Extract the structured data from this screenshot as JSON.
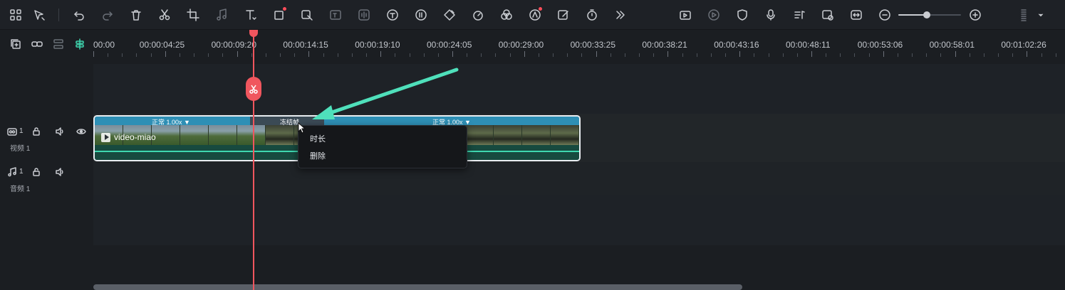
{
  "toolbar": {
    "icons": [
      "grid-icon",
      "select-tool-icon",
      "undo-icon",
      "redo-icon",
      "delete-icon",
      "cut-icon",
      "crop-icon",
      "audio-icon",
      "text-icon",
      "shape-icon",
      "ai-cutout-icon",
      "ai-text-icon",
      "voice-icon",
      "speech-to-text-icon",
      "text-to-speech-icon",
      "keyframe-icon",
      "speed-icon",
      "color-icon",
      "ai-effect-icon",
      "ai-edit-icon",
      "timer-icon",
      "more-icon"
    ],
    "right_icons": [
      "render-icon",
      "preview-icon",
      "shield-icon",
      "microphone-icon",
      "music-list-icon",
      "screen-record-icon",
      "fit-icon",
      "zoom-out-icon",
      "zoom-in-icon",
      "layout-icon"
    ],
    "zoom_level": 0.45
  },
  "ruler": {
    "ticks": [
      "00:00",
      "00:00:04:25",
      "00:00:09:20",
      "00:00:14:15",
      "00:00:19:10",
      "00:00:24:05",
      "00:00:29:00",
      "00:00:33:25",
      "00:00:38:21",
      "00:00:43:16",
      "00:00:48:11",
      "00:00:53:06",
      "00:00:58:01",
      "00:01:02:26"
    ]
  },
  "tracks": {
    "video": {
      "number": "1",
      "label": "视频 1"
    },
    "audio": {
      "number": "1",
      "label": "音频 1"
    }
  },
  "clip": {
    "name": "video-miao",
    "speed_left": "正常 1.00x",
    "freeze": "冻结帧",
    "speed_right": "正常 1.00x"
  },
  "context_menu": {
    "items": [
      "时长",
      "删除"
    ]
  },
  "colors": {
    "playhead": "#f0565e",
    "clip_bar": "#2e8fb5",
    "audio_wave": "#3fd7b0",
    "arrow": "#4fe0bb"
  }
}
